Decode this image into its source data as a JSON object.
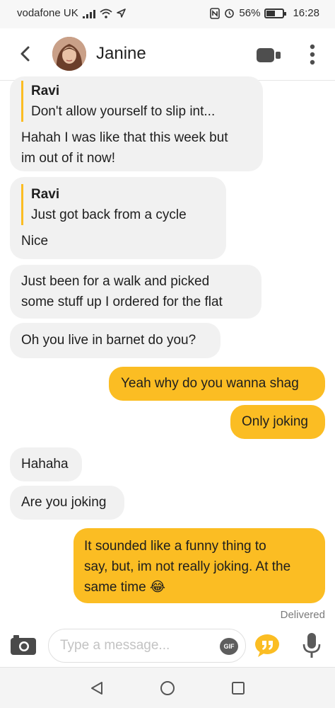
{
  "status_bar": {
    "carrier": "vodafone UK",
    "battery_text": "56%",
    "battery_level": 0.56,
    "time": "16:28",
    "icons": [
      "signal-icon",
      "wifi-icon",
      "location-arrow-icon",
      "nfc-icon",
      "alarm-icon",
      "battery-icon"
    ]
  },
  "header": {
    "contact_name": "Janine",
    "icons": [
      "back-chevron-icon",
      "video-call-icon",
      "more-vertical-icon"
    ]
  },
  "messages": [
    {
      "direction": "in",
      "quote_name": "Ravi",
      "quote_text": "Don't allow yourself to slip int...",
      "lines": [
        "Hahah I was like that this week but",
        "im out of it now!"
      ]
    },
    {
      "direction": "in",
      "quote_name": "Ravi",
      "quote_text": "Just got back from a cycle",
      "lines": [
        "Nice"
      ]
    },
    {
      "direction": "in",
      "lines": [
        "Just been for a walk and picked",
        "some stuff up I ordered for the flat"
      ]
    },
    {
      "direction": "in",
      "lines": [
        "Oh you live in barnet do you?"
      ]
    },
    {
      "direction": "out",
      "lines": [
        "Yeah why do you wanna shag"
      ]
    },
    {
      "direction": "out",
      "lines": [
        "Only joking"
      ]
    },
    {
      "direction": "in",
      "lines": [
        "Hahaha"
      ]
    },
    {
      "direction": "in",
      "lines": [
        "Are you joking"
      ]
    },
    {
      "direction": "out",
      "lines": [
        "It sounded like a funny thing to",
        "say, but, im not really joking. At the",
        "same time 😂"
      ]
    }
  ],
  "delivery_status": "Delivered",
  "composer": {
    "placeholder": "Type a message...",
    "gif_label": "GIF",
    "icons": [
      "camera-icon",
      "gif-icon",
      "quote-icon",
      "microphone-icon"
    ]
  },
  "nav_bar": {
    "icons": [
      "nav-back-icon",
      "nav-home-icon",
      "nav-recents-icon"
    ]
  },
  "colors": {
    "accent": "#fbbd23",
    "incoming_bubble": "#f1f1f1"
  }
}
